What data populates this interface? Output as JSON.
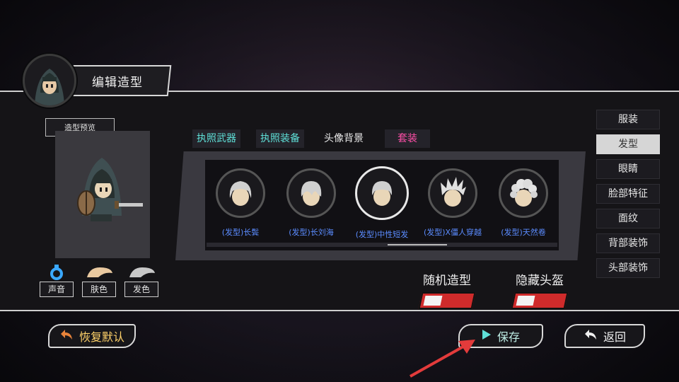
{
  "header": {
    "title": "编辑造型"
  },
  "preview": {
    "label": "造型预览"
  },
  "stats": [
    {
      "label": "声音",
      "color": "#3aa8ff"
    },
    {
      "label": "肤色",
      "color": "#e9c9a0"
    },
    {
      "label": "发色",
      "color": "#c8c8c8"
    }
  ],
  "tabs": [
    {
      "label": "执照武器",
      "color": "cyan"
    },
    {
      "label": "执照装备",
      "color": "cyan"
    },
    {
      "label": "头像背景",
      "color": "white"
    },
    {
      "label": "套装",
      "color": "pink"
    }
  ],
  "items": [
    {
      "name": "(发型)长鬓",
      "selected": false
    },
    {
      "name": "(发型)长刘海",
      "selected": false
    },
    {
      "name": "(发型)中性短发",
      "selected": true
    },
    {
      "name": "(发型)X僵人穿越",
      "selected": false
    },
    {
      "name": "(发型)天然卷",
      "selected": false
    }
  ],
  "toggles": [
    {
      "label": "随机造型"
    },
    {
      "label": "隐藏头盔"
    }
  ],
  "menu": [
    {
      "label": "服装",
      "active": false
    },
    {
      "label": "发型",
      "active": true
    },
    {
      "label": "眼睛",
      "active": false
    },
    {
      "label": "脸部特征",
      "active": false
    },
    {
      "label": "面纹",
      "active": false
    },
    {
      "label": "背部装饰",
      "active": false
    },
    {
      "label": "头部装饰",
      "active": false
    }
  ],
  "buttons": {
    "reset": "恢复默认",
    "save": "保存",
    "back": "返回"
  },
  "colors": {
    "accent_red": "#cf2b2b",
    "link_blue": "#5b8cff",
    "cyan": "#5fe0d8",
    "pink": "#ff4fa8"
  }
}
